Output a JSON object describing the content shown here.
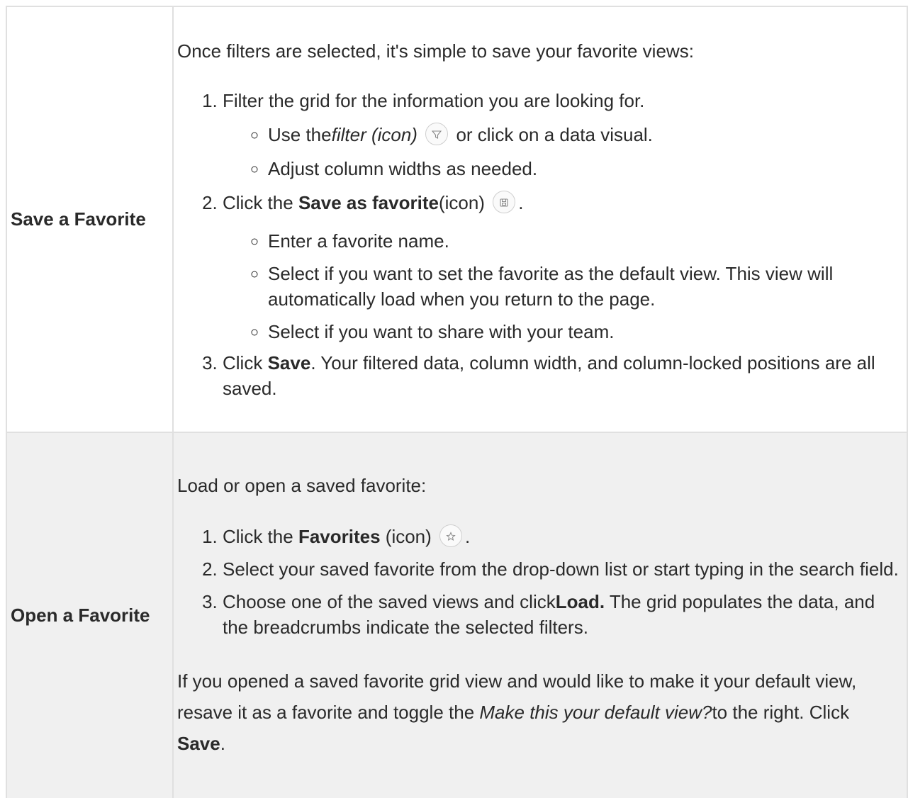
{
  "rows": [
    {
      "label": "Save a Favorite",
      "intro": "Once filters are selected, it's simple to save your favorite views:",
      "step1": "Filter the grid for the information you are looking for.",
      "step1_sub1_pre": "Use the",
      "step1_sub1_italic": "filter (icon)",
      "step1_sub1_post": "or click on a data visual.",
      "step1_sub2": "Adjust column widths as needed.",
      "step2_pre": "Click the",
      "step2_bold": "Save as favorite",
      "step2_post": "(icon)",
      "step2_end": ".",
      "step2_sub1": "Enter a favorite name.",
      "step2_sub2": "Select if you want to set the favorite as the default view. This view will automatically load when you return to the page.",
      "step2_sub3": "Select if you want to share with your team.",
      "step3_pre": "Click",
      "step3_bold": "Save",
      "step3_post": ". Your filtered data, column width, and column-locked positions are all saved.",
      "icons": [
        "filter-icon",
        "save-icon"
      ]
    },
    {
      "label": "Open a Favorite",
      "intro": "Load or open a saved favorite:",
      "step1_pre": "Click the",
      "step1_bold": "Favorites",
      "step1_post": "(icon)",
      "step1_end": ".",
      "step2": "Select your saved favorite from the drop-down list or start typing in the search field.",
      "step3_pre": "Choose one of the saved views and click",
      "step3_bold": "Load.",
      "step3_post": "The grid populates the data, and the breadcrumbs indicate the selected filters.",
      "outro_pre": "If you opened a saved favorite grid view and would like to make it your default view, resave it as a favorite and toggle the",
      "outro_italic": "Make this your default view?",
      "outro_mid": "to the right. Click",
      "outro_bold": "Save",
      "outro_end": ".",
      "icons": [
        "star-icon"
      ]
    }
  ],
  "colors": {
    "border": "#e0e0e0",
    "row2_bg": "#f0f0f0",
    "text": "#2a2a2a"
  }
}
